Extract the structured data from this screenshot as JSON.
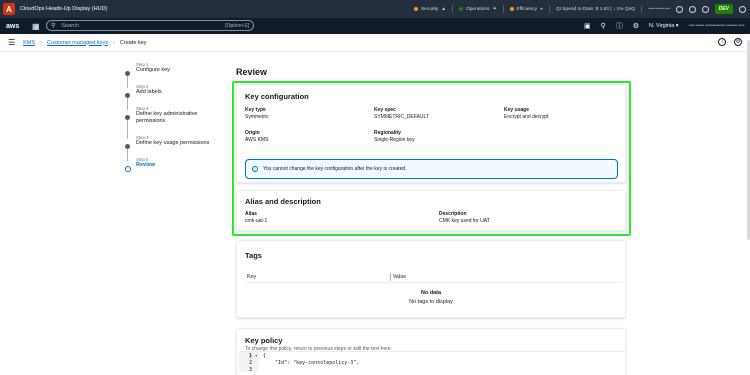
{
  "extension": {
    "logo": "A",
    "title": "CloudOps Heads-Up Display (HUD)",
    "security": "Security",
    "operations": "Operations",
    "efficiency": "Efficiency",
    "spend": "QI Spend to Date: $ 1.63 | ↓ 1% QoQ",
    "account_blurred": "•••••• ••••••• ••••",
    "env_badge": "DEV"
  },
  "topnav": {
    "logo": "aws",
    "search_placeholder": "Search",
    "search_shortcut": "[Option+S]",
    "region": "N. Virginia ▾",
    "account_blurred": "•••• •••••• •••••••••••••• •••••••• ••••"
  },
  "breadcrumb": {
    "items": [
      "KMS",
      "Customer managed keys",
      "Create key"
    ]
  },
  "steps": [
    {
      "num": "Step 1",
      "label": "Configure key"
    },
    {
      "num": "Step 2",
      "label": "Add labels"
    },
    {
      "num": "Step 3",
      "label": "Define key administrative permissions"
    },
    {
      "num": "Step 4",
      "label": "Define key usage permissions"
    },
    {
      "num": "Step 5",
      "label": "Review"
    }
  ],
  "review": {
    "heading": "Review",
    "key_config": {
      "title": "Key configuration",
      "fields": [
        {
          "label": "Key type",
          "value": "Symmetric"
        },
        {
          "label": "Key spec",
          "value": "SYMMETRIC_DEFAULT"
        },
        {
          "label": "Key usage",
          "value": "Encrypt and decrypt"
        },
        {
          "label": "Origin",
          "value": "AWS KMS"
        },
        {
          "label": "Regionality",
          "value": "Single-Region key"
        }
      ],
      "info": "You cannot change the key configuration after the key is created."
    },
    "alias": {
      "title": "Alias and description",
      "alias_label": "Alias",
      "alias_value": "cmk-uat-1",
      "desc_label": "Description",
      "desc_value": "CMK key used for UAT"
    },
    "tags": {
      "title": "Tags",
      "col_key": "Key",
      "col_value": "Value",
      "empty_title": "No data",
      "empty_text": "No tags to display"
    },
    "policy": {
      "title": "Key policy",
      "hint": "To change this policy, return to previous steps or edit the text here.",
      "lines": [
        {
          "n": "1",
          "text": "{"
        },
        {
          "n": "2",
          "text": "    \"Id\": \"key-consolepolicy-3\","
        },
        {
          "n": "3",
          "text": ""
        }
      ]
    }
  }
}
